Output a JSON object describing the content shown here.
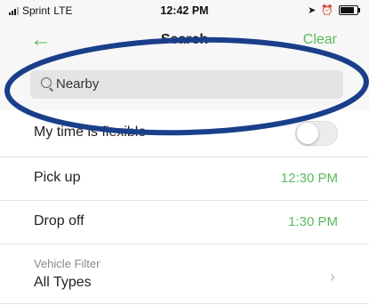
{
  "status_bar": {
    "carrier": "Sprint",
    "network": "LTE",
    "time": "12:42 PM",
    "icons": [
      "signal-icon",
      "location-icon",
      "alarm-icon",
      "battery-icon"
    ]
  },
  "nav": {
    "back_icon": "←",
    "title": "Search",
    "clear_label": "Clear"
  },
  "search": {
    "value": "Nearby"
  },
  "flexible": {
    "label": "My time is flexible",
    "toggle_on": false
  },
  "pickup": {
    "label": "Pick up",
    "value": "12:30 PM"
  },
  "dropoff": {
    "label": "Drop off",
    "value": "1:30 PM"
  },
  "vehicle_filter": {
    "label": "Vehicle Filter",
    "value": "All Types",
    "chevron": "›"
  },
  "colors": {
    "accent": "#5cb85c",
    "annotation": "#1a3f8a"
  }
}
